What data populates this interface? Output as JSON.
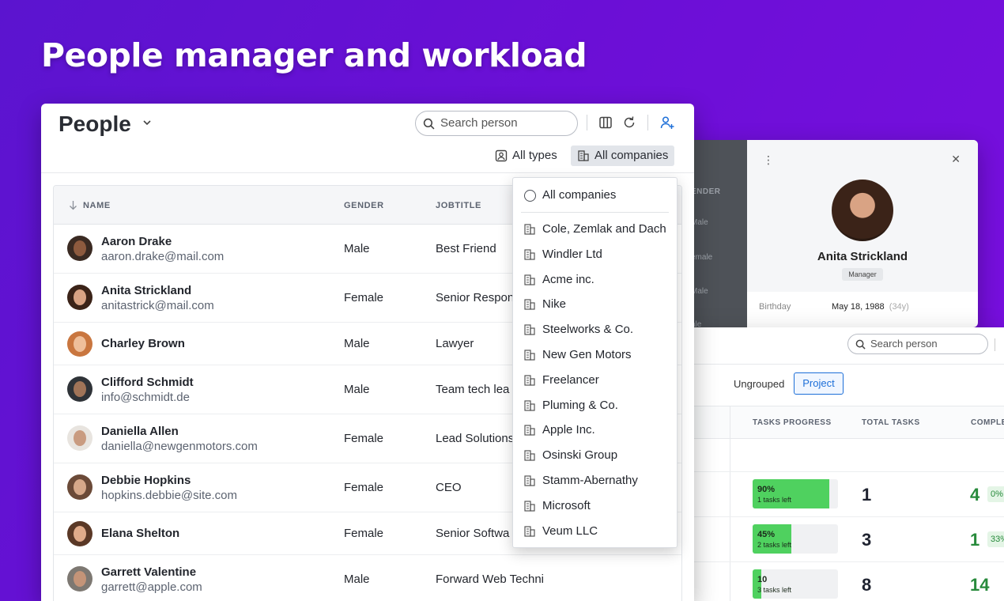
{
  "hero": {
    "title": "People manager and workload"
  },
  "colors": {
    "background": "#6210d4",
    "accent": "#1d6fd8",
    "progress": "#4fd15f",
    "completed": "#278a3b"
  },
  "people": {
    "title": "People",
    "search_placeholder": "Search person",
    "filters": {
      "types": "All types",
      "companies": "All companies"
    },
    "columns": {
      "name": "NAME",
      "gender": "GENDER",
      "jobtitle": "JOBTITLE"
    },
    "rows": [
      {
        "name": "Aaron Drake",
        "email": "aaron.drake@mail.com",
        "gender": "Male",
        "jobtitle": "Best Friend"
      },
      {
        "name": "Anita Strickland",
        "email": "anitastrick@mail.com",
        "gender": "Female",
        "jobtitle": "Senior Respon"
      },
      {
        "name": "Charley Brown",
        "email": "",
        "gender": "Male",
        "jobtitle": "Lawyer"
      },
      {
        "name": "Clifford Schmidt",
        "email": "info@schmidt.de",
        "gender": "Male",
        "jobtitle": "Team tech lea"
      },
      {
        "name": "Daniella Allen",
        "email": "daniella@newgenmotors.com",
        "gender": "Female",
        "jobtitle": "Lead Solutions"
      },
      {
        "name": "Debbie Hopkins",
        "email": "hopkins.debbie@site.com",
        "gender": "Female",
        "jobtitle": "CEO"
      },
      {
        "name": "Elana Shelton",
        "email": "",
        "gender": "Female",
        "jobtitle": "Senior Softwa"
      },
      {
        "name": "Garrett Valentine",
        "email": "garrett@apple.com",
        "gender": "Male",
        "jobtitle": "Forward Web Techni"
      }
    ]
  },
  "company_dropdown": {
    "all_label": "All companies",
    "items": [
      "Cole, Zemlak and Dach",
      "Windler Ltd",
      "Acme inc.",
      "Nike",
      "Steelworks & Co.",
      "New Gen Motors",
      "Freelancer",
      "Pluming & Co.",
      "Apple Inc.",
      "Osinski Group",
      "Stamm-Abernathy",
      "Microsoft",
      "Veum LLC"
    ]
  },
  "detail": {
    "partial_header": "ENDER",
    "partial_values": [
      "Male",
      "emale",
      "Male",
      "ale"
    ],
    "name": "Anita Strickland",
    "role": "Manager",
    "birthday_label": "Birthday",
    "birthday_value": "May 18, 1988",
    "birthday_age": "(34y)"
  },
  "workload": {
    "search_placeholder": "Search person",
    "group_ungrouped": "Ungrouped",
    "group_project": "Project",
    "columns": {
      "progress": "TASKS PROGRESS",
      "total": "TOTAL TASKS",
      "completed": "COMPLE"
    },
    "rows": [
      {
        "progress_label": "90%",
        "progress": 0.9,
        "tasks_left": "1 tasks left",
        "total": "1",
        "completed": "4",
        "completed_pct": "0%"
      },
      {
        "progress_label": "45%",
        "progress": 0.45,
        "tasks_left": "2 tasks left",
        "total": "3",
        "completed": "1",
        "completed_pct": "33%"
      },
      {
        "progress_label": "10",
        "progress": 0.1,
        "tasks_left": "3 tasks left",
        "total": "8",
        "completed": "14",
        "completed_pct": ""
      }
    ]
  }
}
